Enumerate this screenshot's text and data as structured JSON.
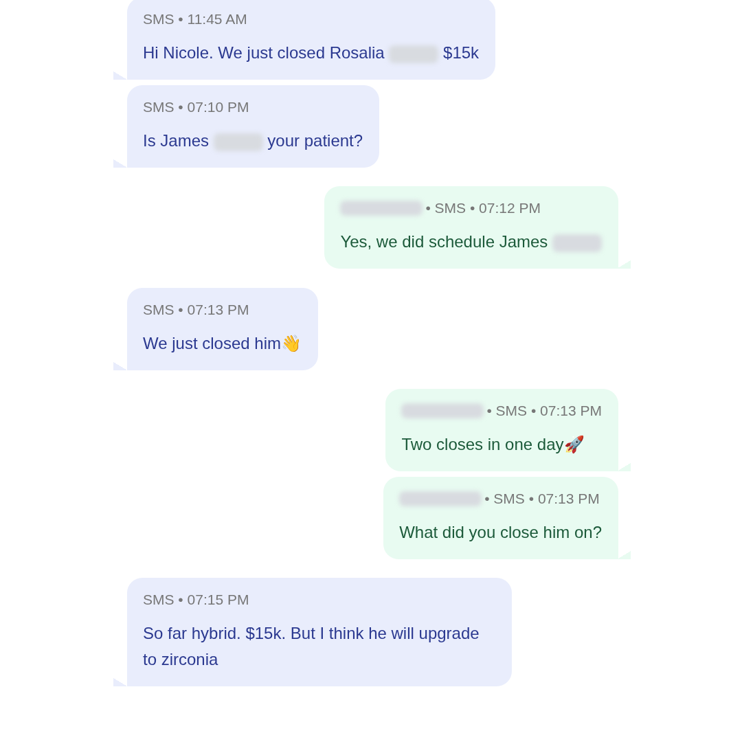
{
  "messages": [
    {
      "kind": "incoming",
      "meta": "SMS • 11:45 AM",
      "parts": [
        {
          "kind": "text",
          "text": "Hi Nicole. We just closed Rosalia "
        },
        {
          "kind": "redacted"
        },
        {
          "kind": "text",
          "text": " $15k"
        }
      ]
    },
    {
      "kind": "incoming",
      "meta": "SMS • 07:10 PM",
      "parts": [
        {
          "kind": "text",
          "text": "Is James "
        },
        {
          "kind": "redacted"
        },
        {
          "kind": "text",
          "text": " your patient?"
        }
      ]
    },
    {
      "kind": "outgoing",
      "sender_redacted": true,
      "meta": "• SMS • 07:12 PM",
      "parts": [
        {
          "kind": "text",
          "text": "Yes, we did schedule James "
        },
        {
          "kind": "redacted"
        }
      ]
    },
    {
      "kind": "incoming",
      "meta": "SMS • 07:13 PM",
      "parts": [
        {
          "kind": "text",
          "text": "We just closed him👋"
        }
      ]
    },
    {
      "kind": "outgoing",
      "sender_redacted": true,
      "meta": "• SMS • 07:13 PM",
      "parts": [
        {
          "kind": "text",
          "text": "Two closes in one day🚀"
        }
      ]
    },
    {
      "kind": "outgoing",
      "sender_redacted": true,
      "meta": "• SMS • 07:13 PM",
      "parts": [
        {
          "kind": "text",
          "text": "What did you close him on?"
        }
      ]
    },
    {
      "kind": "incoming",
      "meta": "SMS • 07:15 PM",
      "parts": [
        {
          "kind": "text",
          "text": "So far hybrid. $15k. But I think he will upgrade to zirconia"
        }
      ]
    }
  ]
}
